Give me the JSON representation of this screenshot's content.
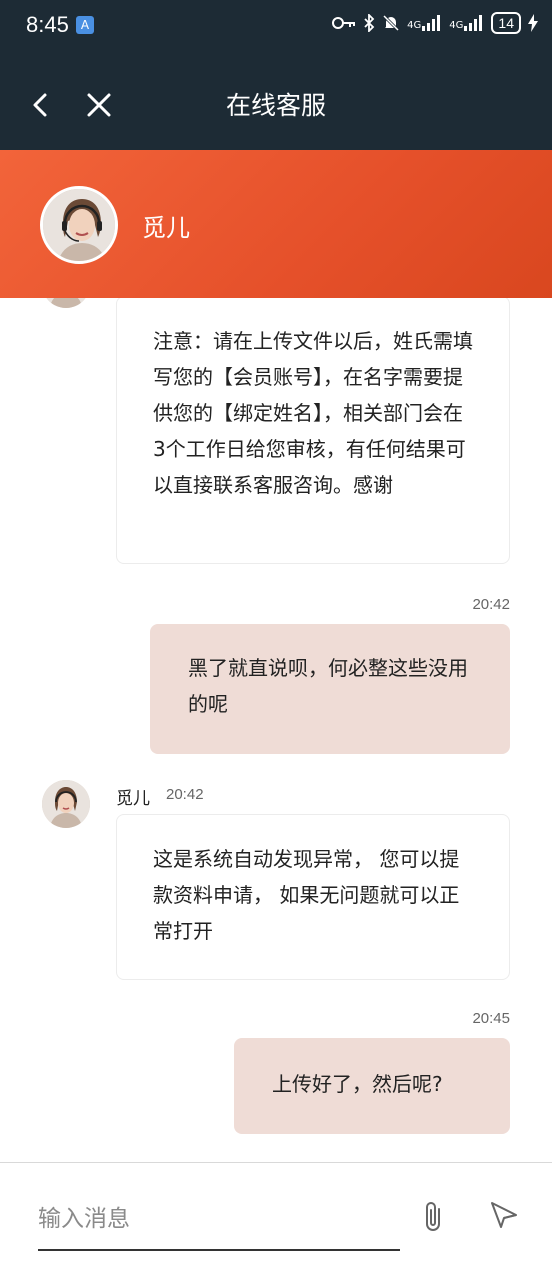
{
  "status_bar": {
    "time": "8:45",
    "app_icon": "A",
    "battery": "14",
    "icons": [
      "key-icon",
      "bluetooth-icon",
      "bell-muted-icon",
      "signal-4g-icon",
      "signal-4g-hd-icon",
      "charging-icon"
    ],
    "net1": "4G",
    "net2": "4G"
  },
  "app_bar": {
    "title": "在线客服",
    "back_icon": "chevron-left-icon",
    "close_icon": "close-icon"
  },
  "agent": {
    "name": "觅儿"
  },
  "messages": [
    {
      "type": "incoming",
      "text": "注意：请在上传文件以后，姓氏需填写您的【会员账号】，在名字需要提供您的【绑定姓名】，相关部门会在3个工作日给您审核，有任何结果可以直接联系客服咨询。感谢"
    },
    {
      "type": "outgoing",
      "time": "20:42",
      "text": "黑了就直说呗，何必整这些没用的呢"
    },
    {
      "type": "incoming",
      "sender": "觅儿",
      "time": "20:42",
      "text": "这是系统自动发现异常， 您可以提款资料申请， 如果无问题就可以正常打开"
    },
    {
      "type": "outgoing",
      "time": "20:45",
      "text": "上传好了，然后呢?"
    }
  ],
  "input": {
    "placeholder": "输入消息",
    "value": ""
  },
  "colors": {
    "header_dark": "#1d2b35",
    "accent": "#e5502a",
    "outgoing_bubble": "#efdcd6"
  }
}
